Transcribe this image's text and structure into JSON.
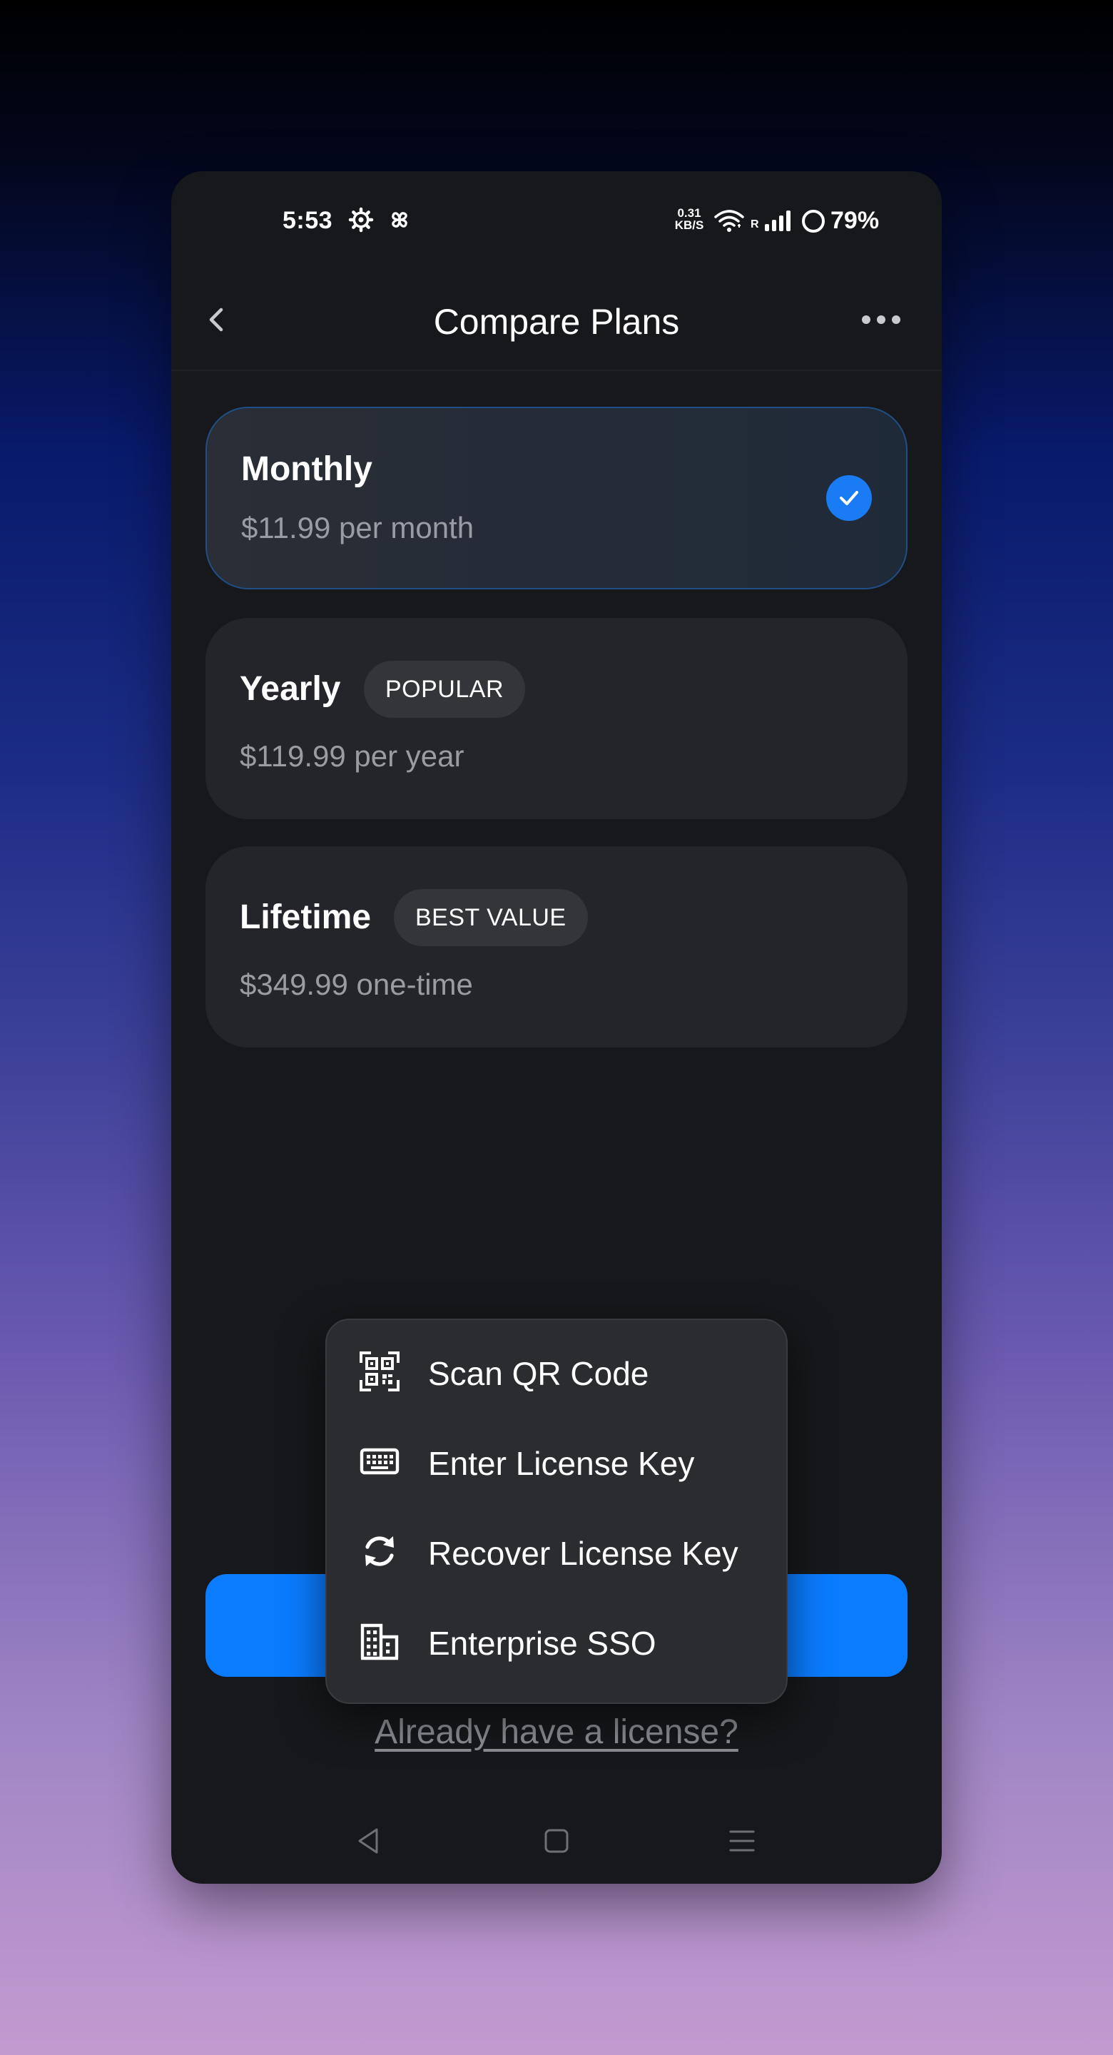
{
  "status_bar": {
    "time": "5:53",
    "net_speed_value": "0.31",
    "net_speed_unit": "KB/S",
    "signal_label": "R",
    "battery": "79%"
  },
  "header": {
    "title": "Compare Plans"
  },
  "plans": [
    {
      "name": "Monthly",
      "price": "$11.99 per month",
      "badge": "",
      "selected": true
    },
    {
      "name": "Yearly",
      "price": "$119.99 per year",
      "badge": "POPULAR",
      "selected": false
    },
    {
      "name": "Lifetime",
      "price": "$349.99 one-time",
      "badge": "BEST VALUE",
      "selected": false
    }
  ],
  "cta": {
    "label": ""
  },
  "license_link": "Already have a license?",
  "license_menu": {
    "items": [
      {
        "label": "Scan QR Code",
        "icon": "qr-code-icon"
      },
      {
        "label": "Enter License Key",
        "icon": "keyboard-icon"
      },
      {
        "label": "Recover License Key",
        "icon": "refresh-icon"
      },
      {
        "label": "Enterprise SSO",
        "icon": "building-icon"
      }
    ]
  },
  "colors": {
    "accent": "#0a7cff",
    "surface": "#17181b",
    "card": "#24252a",
    "menu": "#2b2c30"
  }
}
